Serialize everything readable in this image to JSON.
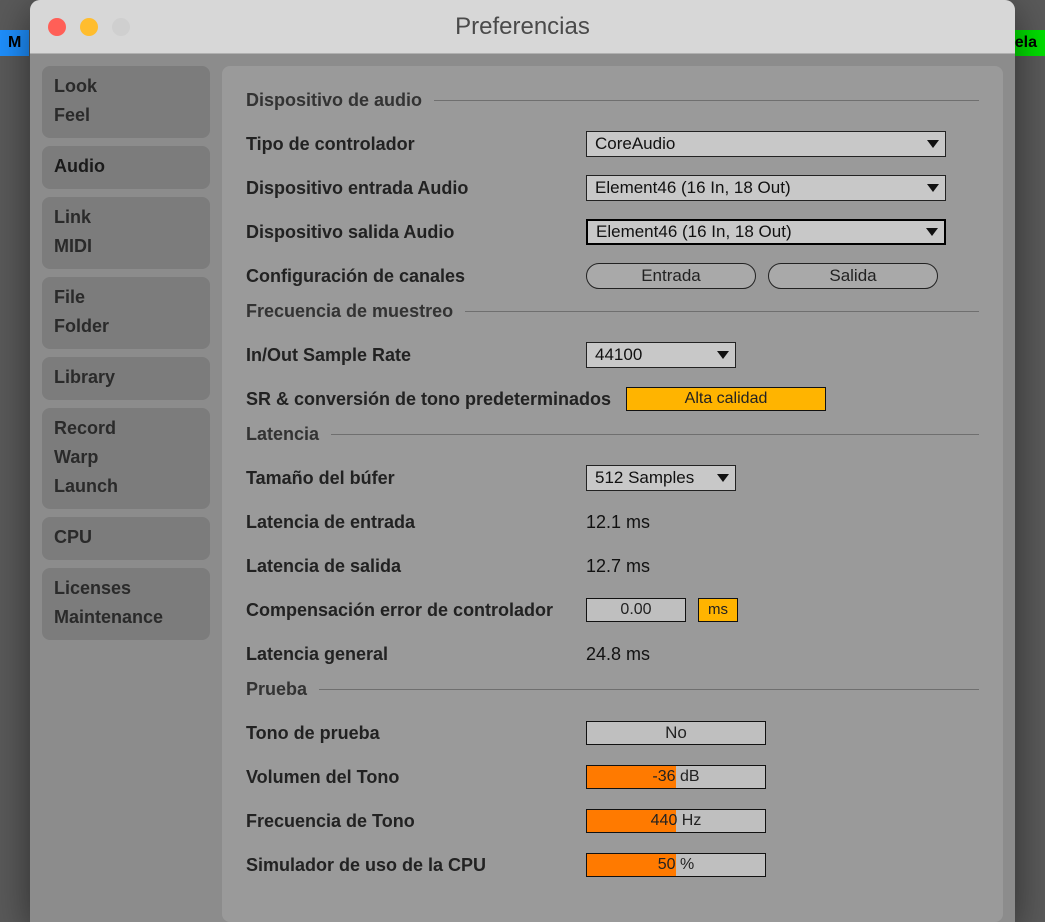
{
  "window": {
    "title": "Preferencias"
  },
  "bg": {
    "left": "M",
    "right": "ela"
  },
  "sidebar": {
    "groups": [
      {
        "items": [
          "Look",
          "Feel"
        ]
      },
      {
        "items": [
          "Audio"
        ],
        "active": true
      },
      {
        "items": [
          "Link",
          "MIDI"
        ]
      },
      {
        "items": [
          "File",
          "Folder"
        ]
      },
      {
        "items": [
          "Library"
        ]
      },
      {
        "items": [
          "Record",
          "Warp",
          "Launch"
        ]
      },
      {
        "items": [
          "CPU"
        ]
      },
      {
        "items": [
          "Licenses",
          "Maintenance"
        ]
      }
    ]
  },
  "sections": {
    "audio_device": "Dispositivo de audio",
    "sample_rate": "Frecuencia de muestreo",
    "latency": "Latencia",
    "test": "Prueba"
  },
  "labels": {
    "driver_type": "Tipo de controlador",
    "input_device": "Dispositivo entrada Audio",
    "output_device": "Dispositivo salida Audio",
    "channel_config": "Configuración de canales",
    "sample_rate": "In/Out Sample Rate",
    "sr_pitch": "SR & conversión de tono predeterminados",
    "buffer_size": "Tamaño del búfer",
    "input_latency": "Latencia de entrada",
    "output_latency": "Latencia de salida",
    "driver_comp": "Compensación error de controlador",
    "overall_latency": "Latencia general",
    "test_tone": "Tono de prueba",
    "tone_volume": "Volumen del Tono",
    "tone_freq": "Frecuencia de Tono",
    "cpu_sim": "Simulador de uso de la CPU"
  },
  "values": {
    "driver_type": "CoreAudio",
    "input_device": "Element46 (16 In, 18 Out)",
    "output_device": "Element46 (16 In, 18 Out)",
    "btn_input": "Entrada",
    "btn_output": "Salida",
    "sample_rate": "44100",
    "sr_pitch_mode": "Alta calidad",
    "buffer_size": "512 Samples",
    "input_latency": "12.1 ms",
    "output_latency": "12.7 ms",
    "driver_comp": "0.00",
    "driver_comp_unit": "ms",
    "overall_latency": "24.8 ms",
    "test_tone": "No",
    "tone_volume_text": "-36 dB",
    "tone_volume_fill_pct": 50,
    "tone_freq_text": "440 Hz",
    "tone_freq_fill_pct": 50,
    "cpu_sim_text": "50 %",
    "cpu_sim_fill_pct": 50
  }
}
